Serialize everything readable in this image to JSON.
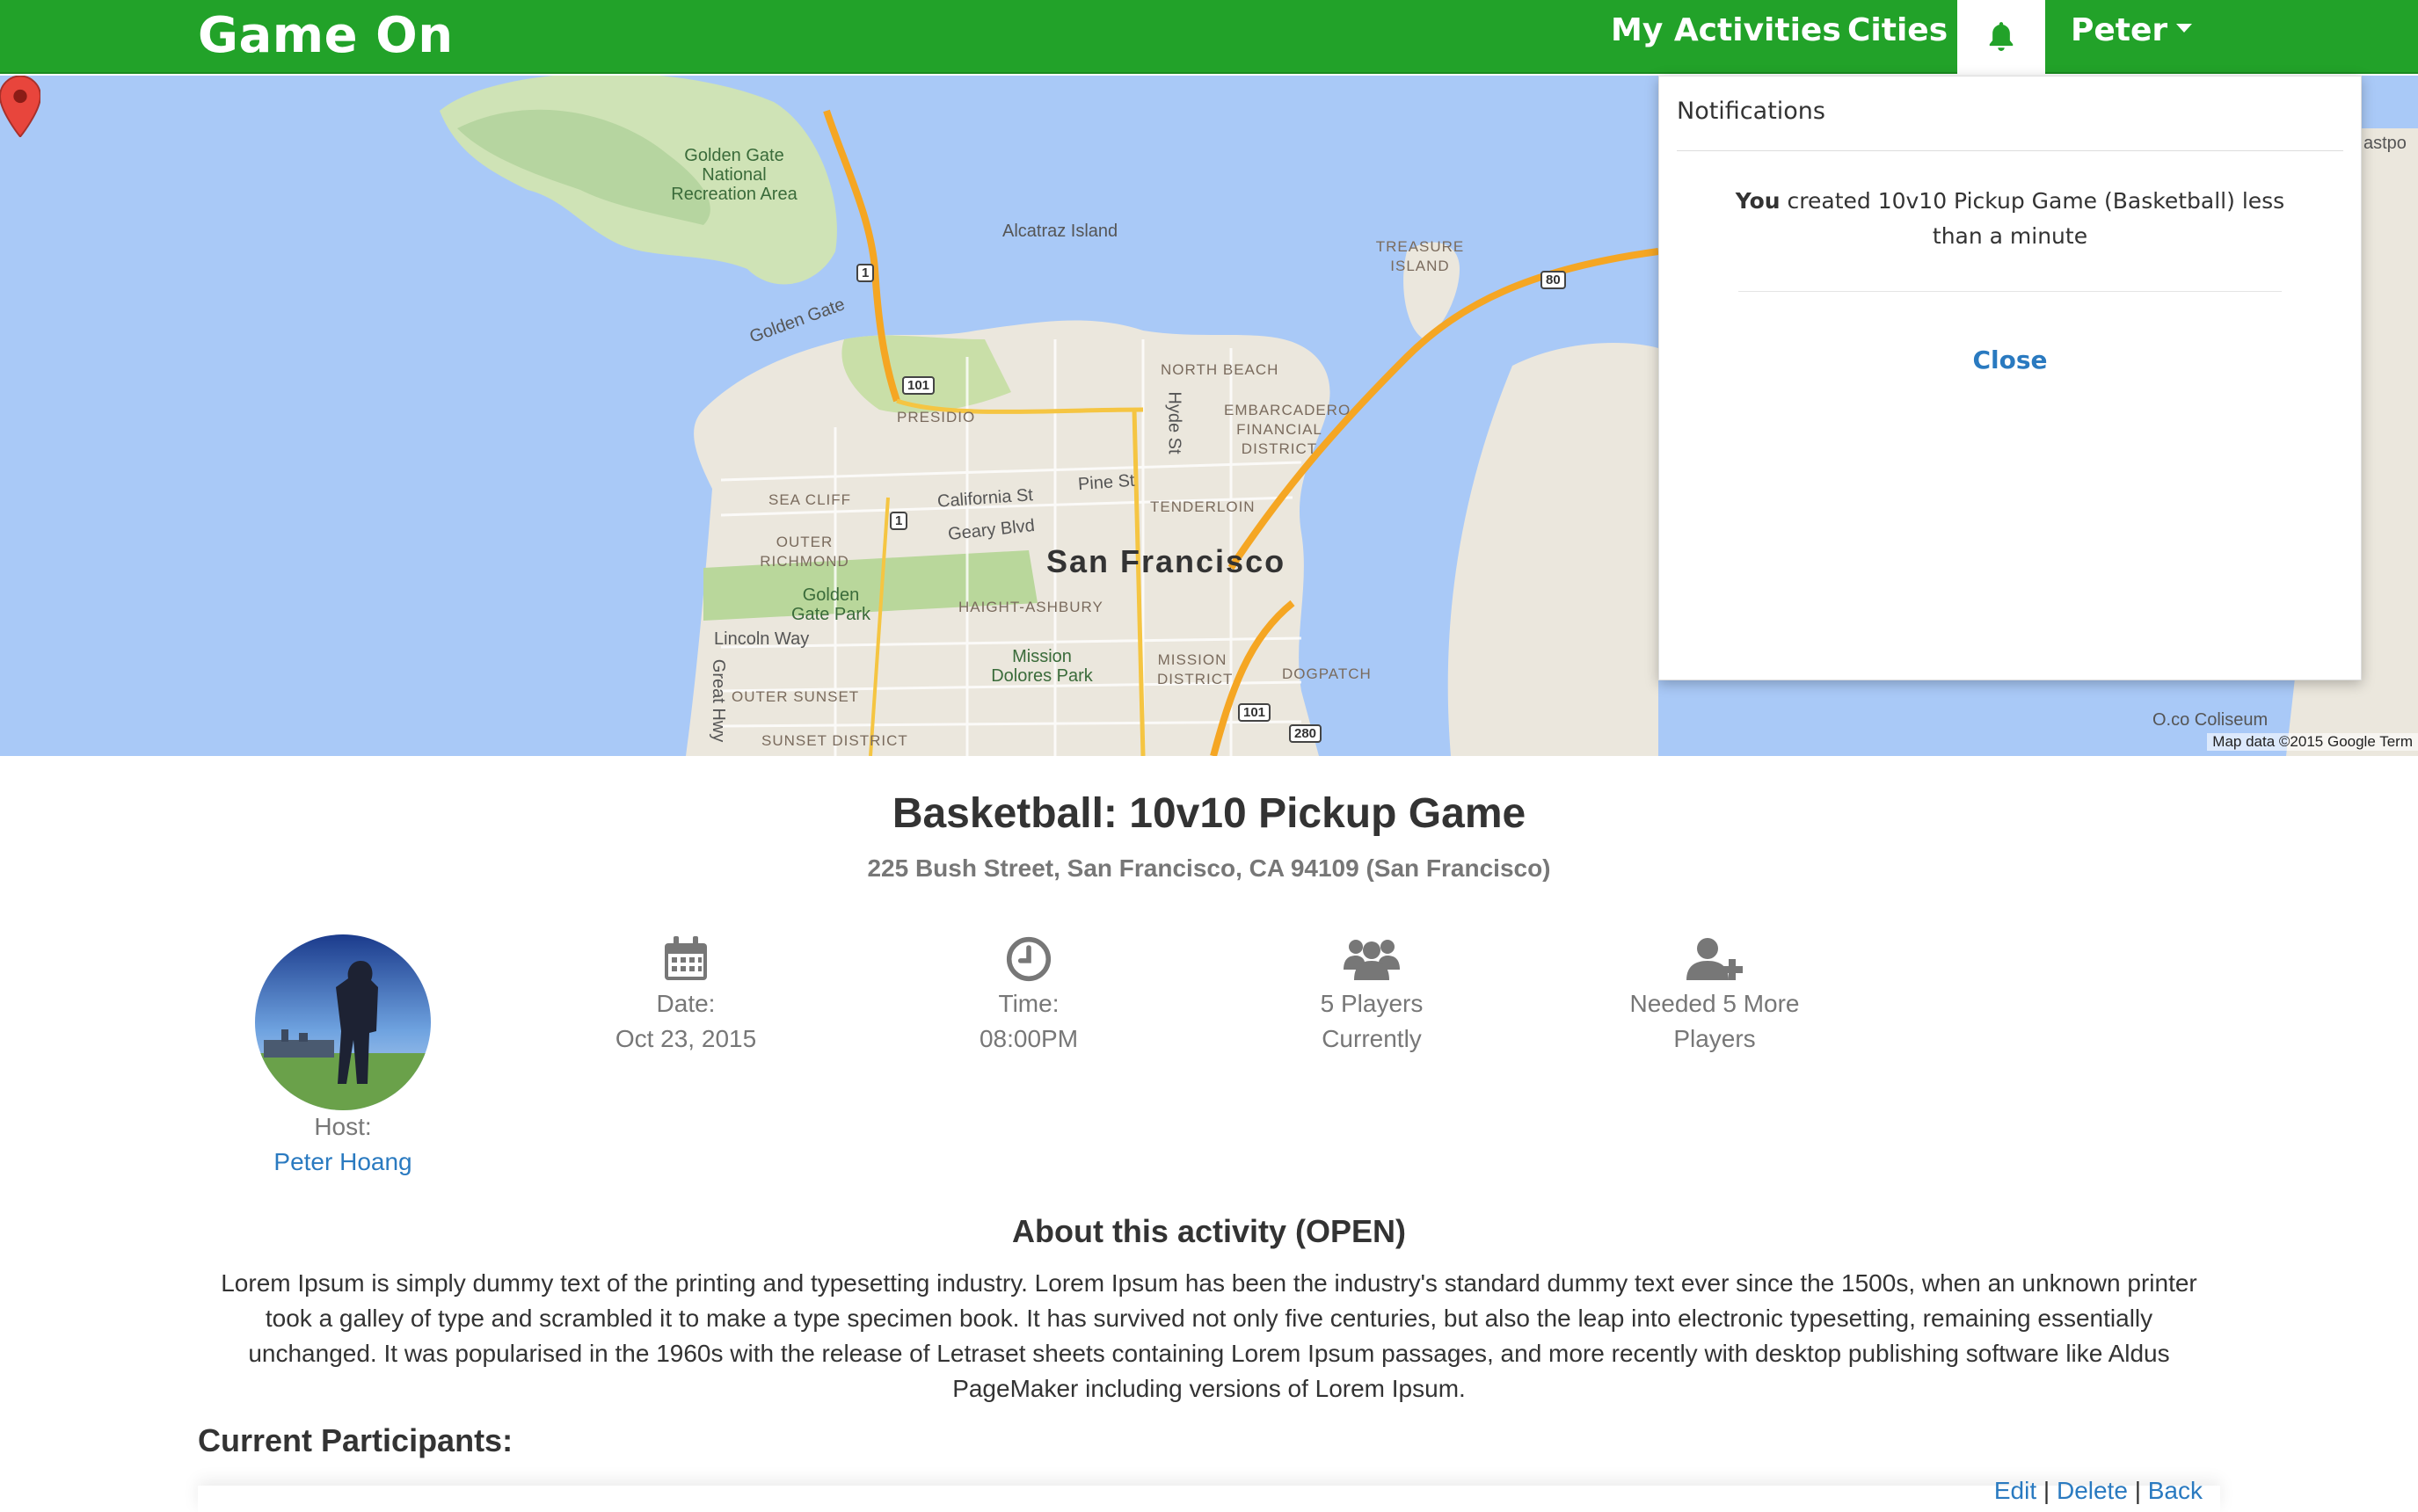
{
  "nav": {
    "brand": "Game On",
    "my_activities": "My Activities",
    "cities": "Cities",
    "user": "Peter",
    "bell_icon": "bell-icon",
    "brand_color": "#22a229"
  },
  "map": {
    "labels": {
      "golden_gate_nra": "Golden Gate National Recreation Area",
      "alcatraz": "Alcatraz Island",
      "treasure_island": "TREASURE ISLAND",
      "golden_gate": "Golden Gate",
      "north_beach": "NORTH BEACH",
      "embarcadero": "EMBARCADERO",
      "financial_district": "FINANCIAL DISTRICT",
      "presidio": "PRESIDIO",
      "sea_cliff": "SEA CLIFF",
      "california_st": "California St",
      "pine_st": "Pine St",
      "geary_blvd": "Geary Blvd",
      "tenderloin": "TENDERLOIN",
      "hyde_st": "Hyde St",
      "outer_richmond": "OUTER RICHMOND",
      "san_francisco": "San Francisco",
      "golden_gate_park": "Golden Gate Park",
      "haight_ashbury": "HAIGHT-ASHBURY",
      "lincoln_way": "Lincoln Way",
      "mission_dolores_park": "Mission Dolores Park",
      "mission_district": "MISSION DISTRICT",
      "dogpatch": "DOGPATCH",
      "outer_sunset": "OUTER SUNSET",
      "sunset_district": "SUNSET DISTRICT",
      "great_hwy": "Great Hwy",
      "coliseum": "O.co Coliseum",
      "eastport": "astpo"
    },
    "shields": {
      "r1a": "1",
      "r1b": "1",
      "r101a": "101",
      "r101b": "101",
      "r80": "80",
      "r280": "280"
    },
    "credit": "Map data ©2015 Google",
    "terms": "Term"
  },
  "notifications": {
    "title": "Notifications",
    "actor": "You",
    "message": "created 10v10 Pickup Game (Basketball) less than a minute",
    "close": "Close"
  },
  "activity": {
    "title": "Basketball: 10v10 Pickup Game",
    "address": "225 Bush Street, San Francisco, CA 94109 (San Francisco)",
    "host_label": "Host:",
    "host_name": "Peter Hoang",
    "date_label": "Date:",
    "date_value": "Oct 23, 2015",
    "time_label": "Time:",
    "time_value": "08:00PM",
    "players_line1": "5 Players",
    "players_line2": "Currently",
    "needed_line1": "Needed 5 More",
    "needed_line2": "Players",
    "about_title": "About this activity (OPEN)",
    "about_text": "Lorem Ipsum is simply dummy text of the printing and typesetting industry. Lorem Ipsum has been the industry's standard dummy text ever since the 1500s, when an unknown printer took a galley of type and scrambled it to make a type specimen book. It has survived not only five centuries, but also the leap into electronic typesetting, remaining essentially unchanged. It was popularised in the 1960s with the release of Letraset sheets containing Lorem Ipsum passages, and more recently with desktop publishing software like Aldus PageMaker including versions of Lorem Ipsum.",
    "participants_title": "Current Participants:",
    "icons": [
      "calendar-icon",
      "clock-icon",
      "group-icon",
      "add-user-icon"
    ]
  },
  "actions": {
    "edit": "Edit",
    "delete": "Delete",
    "back": "Back",
    "separator": "|"
  }
}
